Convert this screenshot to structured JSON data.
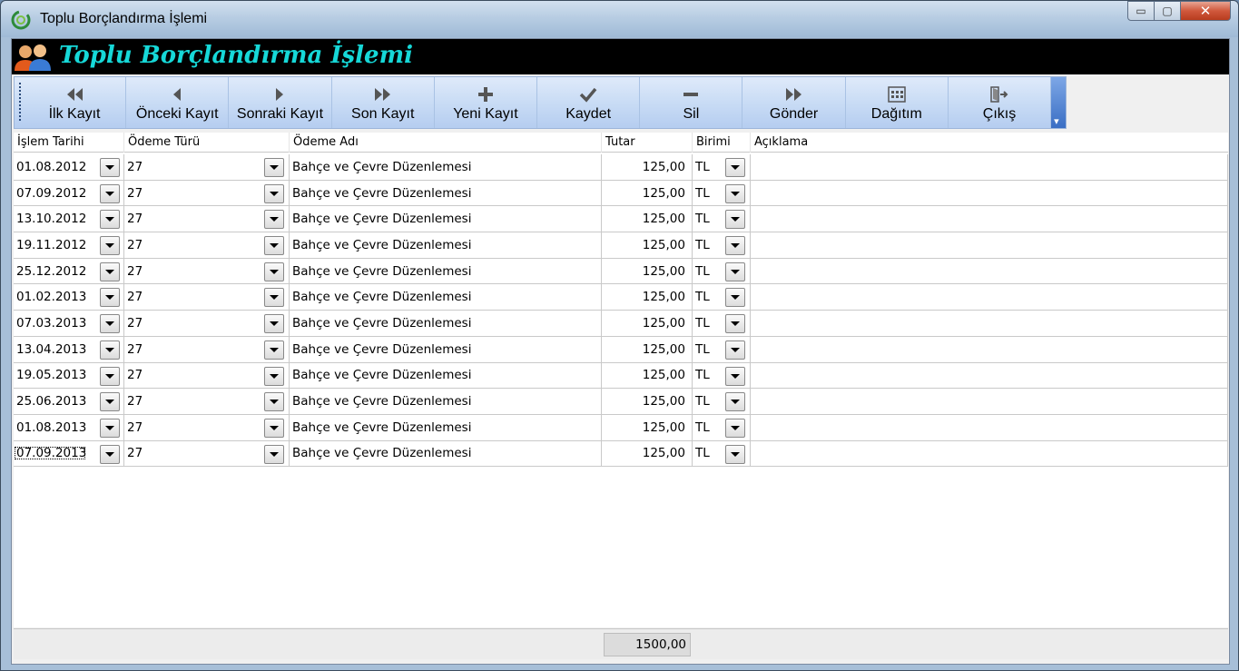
{
  "window": {
    "title": "Toplu Borçlandırma İşlemi",
    "controls": {
      "minimize": "▭",
      "maximize": "▢",
      "close": "✕"
    }
  },
  "banner": {
    "title": "Toplu Borçlandırma İşlemi",
    "icon": "users-icon",
    "title_color": "#16d8d8"
  },
  "toolbar": {
    "buttons": [
      {
        "label": "İlk Kayıt",
        "icon": "first-record-icon"
      },
      {
        "label": "Önceki Kayıt",
        "icon": "previous-record-icon"
      },
      {
        "label": "Sonraki Kayıt",
        "icon": "next-record-icon"
      },
      {
        "label": "Son Kayıt",
        "icon": "last-record-icon"
      },
      {
        "label": "Yeni Kayıt",
        "icon": "plus-icon"
      },
      {
        "label": "Kaydet",
        "icon": "check-icon"
      },
      {
        "label": "Sil",
        "icon": "minus-icon"
      },
      {
        "label": "Gönder",
        "icon": "send-icon"
      },
      {
        "label": "Dağıtım",
        "icon": "grid-icon"
      },
      {
        "label": "Çıkış",
        "icon": "exit-door-icon"
      }
    ]
  },
  "grid": {
    "columns": [
      "İşlem Tarihi",
      "Ödeme Türü",
      "Ödeme Adı",
      "Tutar",
      "Birimi",
      "Açıklama"
    ],
    "rows": [
      {
        "tarih": "01.08.2012",
        "tur": "27",
        "ad": "Bahçe ve Çevre Düzenlemesi",
        "tutar": "125,00",
        "birim": "TL",
        "aciklama": ""
      },
      {
        "tarih": "07.09.2012",
        "tur": "27",
        "ad": "Bahçe ve Çevre Düzenlemesi",
        "tutar": "125,00",
        "birim": "TL",
        "aciklama": ""
      },
      {
        "tarih": "13.10.2012",
        "tur": "27",
        "ad": "Bahçe ve Çevre Düzenlemesi",
        "tutar": "125,00",
        "birim": "TL",
        "aciklama": ""
      },
      {
        "tarih": "19.11.2012",
        "tur": "27",
        "ad": "Bahçe ve Çevre Düzenlemesi",
        "tutar": "125,00",
        "birim": "TL",
        "aciklama": ""
      },
      {
        "tarih": "25.12.2012",
        "tur": "27",
        "ad": "Bahçe ve Çevre Düzenlemesi",
        "tutar": "125,00",
        "birim": "TL",
        "aciklama": ""
      },
      {
        "tarih": "01.02.2013",
        "tur": "27",
        "ad": "Bahçe ve Çevre Düzenlemesi",
        "tutar": "125,00",
        "birim": "TL",
        "aciklama": ""
      },
      {
        "tarih": "07.03.2013",
        "tur": "27",
        "ad": "Bahçe ve Çevre Düzenlemesi",
        "tutar": "125,00",
        "birim": "TL",
        "aciklama": ""
      },
      {
        "tarih": "13.04.2013",
        "tur": "27",
        "ad": "Bahçe ve Çevre Düzenlemesi",
        "tutar": "125,00",
        "birim": "TL",
        "aciklama": ""
      },
      {
        "tarih": "19.05.2013",
        "tur": "27",
        "ad": "Bahçe ve Çevre Düzenlemesi",
        "tutar": "125,00",
        "birim": "TL",
        "aciklama": ""
      },
      {
        "tarih": "25.06.2013",
        "tur": "27",
        "ad": "Bahçe ve Çevre Düzenlemesi",
        "tutar": "125,00",
        "birim": "TL",
        "aciklama": ""
      },
      {
        "tarih": "01.08.2013",
        "tur": "27",
        "ad": "Bahçe ve Çevre Düzenlemesi",
        "tutar": "125,00",
        "birim": "TL",
        "aciklama": ""
      },
      {
        "tarih": "07.09.2013",
        "tur": "27",
        "ad": "Bahçe ve Çevre Düzenlemesi",
        "tutar": "125,00",
        "birim": "TL",
        "aciklama": ""
      }
    ]
  },
  "footer": {
    "total": "1500,00"
  }
}
